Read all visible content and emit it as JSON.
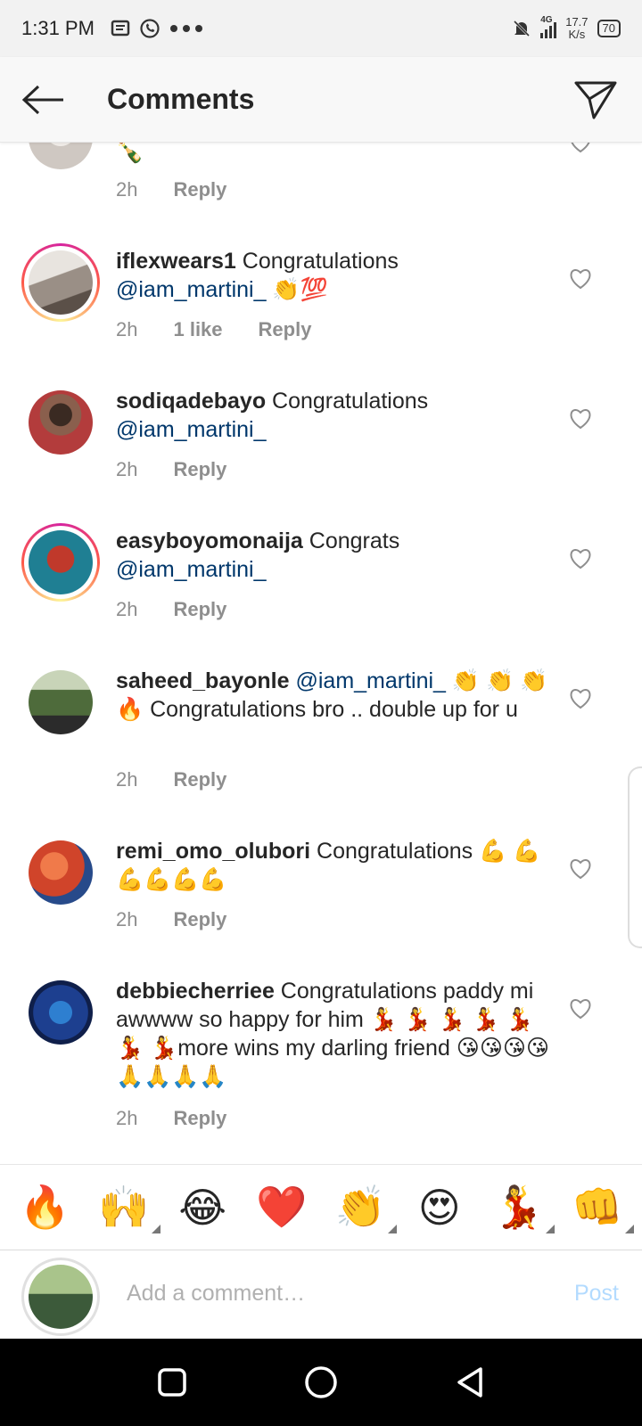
{
  "status_bar": {
    "time": "1:31 PM",
    "left_icons": [
      "message-icon",
      "whatsapp-icon",
      "more-dots-icon"
    ],
    "network": "4G",
    "speed_value": "17.7",
    "speed_unit": "K/s",
    "battery": "70"
  },
  "header": {
    "title": "Comments"
  },
  "comments": [
    {
      "username": "",
      "text": "🍾",
      "time": "2h",
      "likes": "",
      "reply": "Reply",
      "avatar_color": "#cfc8c2",
      "story_ring": false
    },
    {
      "username": "iflexwears1",
      "text_before": " Congratulations ",
      "mention": "@iam_martini_",
      "text_after": " 👏💯",
      "time": "2h",
      "likes": "1 like",
      "reply": "Reply",
      "avatar_color": "#9a8f86",
      "story_ring": true
    },
    {
      "username": "sodiqadebayo",
      "text_before": " Congratulations ",
      "mention": "@iam_martini_",
      "text_after": "",
      "time": "2h",
      "likes": "",
      "reply": "Reply",
      "avatar_color": "#7c5a4a",
      "story_ring": false
    },
    {
      "username": "easyboyomonaija",
      "text_before": " Congrats ",
      "mention": "@iam_martini_",
      "text_after": "",
      "time": "2h",
      "likes": "",
      "reply": "Reply",
      "avatar_color": "#2a9bb0",
      "story_ring": true
    },
    {
      "username": "saheed_bayonle",
      "text_before": " ",
      "mention": "@iam_martini_",
      "text_after": " 👏 👏 👏 🔥 Congratulations bro .. double up for u",
      "time": "2h",
      "likes": "",
      "reply": "Reply",
      "avatar_color": "#6b7a4f",
      "story_ring": false
    },
    {
      "username": "remi_omo_olubori",
      "text_before": " Congratulations 💪 💪💪💪💪💪",
      "mention": "",
      "text_after": "",
      "time": "2h",
      "likes": "",
      "reply": "Reply",
      "avatar_color": "#d0442a",
      "story_ring": false
    },
    {
      "username": "debbiecherriee",
      "text_before": " Congratulations paddy mi awwww so happy for him 💃 💃 💃 💃 💃 💃 💃more wins my darling friend 😘😘😘😘🙏🙏🙏🙏",
      "mention": "",
      "text_after": "",
      "time": "2h",
      "likes": "",
      "reply": "Reply",
      "avatar_color": "#1d3f8f",
      "story_ring": false
    }
  ],
  "emoji_bar": [
    "🔥",
    "🙌",
    "😂",
    "❤️",
    "👏",
    "😍",
    "💃",
    "👊"
  ],
  "composer": {
    "placeholder": "Add a comment…",
    "post_label": "Post",
    "avatar_color": "#8aa36b"
  },
  "nav_bar": [
    "square-recents-icon",
    "circle-home-icon",
    "triangle-back-icon"
  ]
}
